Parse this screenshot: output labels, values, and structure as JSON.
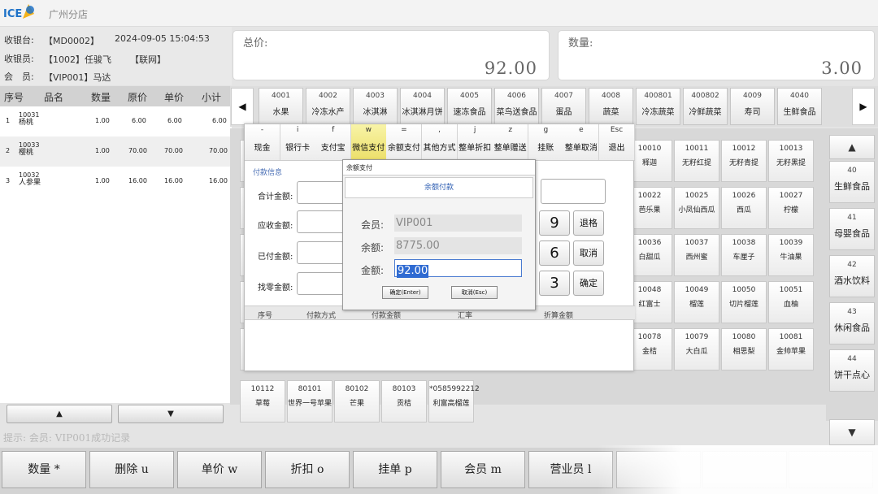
{
  "app": {
    "logo_text": "ICE",
    "store": "广州分店"
  },
  "info": {
    "register_label": "收银台:",
    "register_value": "【MD0002】",
    "datetime": "2024-09-05 15:04:53",
    "cashier_label": "收银员:",
    "cashier_value": "【1002】任骏飞",
    "network": "【联网】",
    "member_label": "会　员:",
    "member_value": "【VIP001】马达"
  },
  "totals": {
    "total_label": "总价:",
    "total_value": "92.00",
    "qty_label": "数量:",
    "qty_value": "3.00"
  },
  "list": {
    "headers": [
      "序号",
      "品名",
      "数量",
      "原价",
      "单价",
      "小计"
    ],
    "rows": [
      {
        "no": "1",
        "code": "10031",
        "name": "杨桃",
        "qty": "1.00",
        "orig": "6.00",
        "price": "6.00",
        "sub": "6.00"
      },
      {
        "no": "2",
        "code": "10033",
        "name": "樱桃",
        "qty": "1.00",
        "orig": "70.00",
        "price": "70.00",
        "sub": "70.00"
      },
      {
        "no": "3",
        "code": "10032",
        "name": "人参果",
        "qty": "1.00",
        "orig": "16.00",
        "price": "16.00",
        "sub": "16.00"
      }
    ],
    "scroll_up": "▲",
    "scroll_down": "▼"
  },
  "hint": "提示: 会员: VIP001成功记录",
  "categories": {
    "prev": "◀",
    "next": "▶",
    "items": [
      {
        "code": "4001",
        "name": "水果"
      },
      {
        "code": "4002",
        "name": "冷冻水产"
      },
      {
        "code": "4003",
        "name": "冰淇淋"
      },
      {
        "code": "4004",
        "name": "冰淇淋月饼"
      },
      {
        "code": "4005",
        "name": "速冻食品"
      },
      {
        "code": "4006",
        "name": "菜鸟送食品"
      },
      {
        "code": "4007",
        "name": "蛋品"
      },
      {
        "code": "4008",
        "name": "蔬菜"
      },
      {
        "code": "400801",
        "name": "冷冻蔬菜"
      },
      {
        "code": "400802",
        "name": "冷鲜蔬菜"
      },
      {
        "code": "4009",
        "name": "寿司"
      },
      {
        "code": "4040",
        "name": "生鲜食品"
      }
    ]
  },
  "products": [
    {
      "code": "10010",
      "name": "释迦"
    },
    {
      "code": "10011",
      "name": "无籽红提"
    },
    {
      "code": "10012",
      "name": "无籽青提"
    },
    {
      "code": "10013",
      "name": "无籽黑提"
    },
    {
      "code": "10022",
      "name": "芭乐果"
    },
    {
      "code": "10025",
      "name": "小凤仙西瓜"
    },
    {
      "code": "10026",
      "name": "西瓜"
    },
    {
      "code": "10027",
      "name": "柠檬"
    },
    {
      "code": "10036",
      "name": "白甜瓜"
    },
    {
      "code": "10037",
      "name": "西州蜜"
    },
    {
      "code": "10038",
      "name": "车厘子"
    },
    {
      "code": "10039",
      "name": "牛油果"
    },
    {
      "code": "10048",
      "name": "红富士"
    },
    {
      "code": "10049",
      "name": "榴莲"
    },
    {
      "code": "10050",
      "name": "切片榴莲"
    },
    {
      "code": "10051",
      "name": "血柚"
    },
    {
      "code": "10078",
      "name": "金桔"
    },
    {
      "code": "10079",
      "name": "大白瓜"
    },
    {
      "code": "10080",
      "name": "相思梨"
    },
    {
      "code": "10081",
      "name": "金帅苹果"
    }
  ],
  "products_bottom": [
    {
      "code": "10112",
      "name": "草莓"
    },
    {
      "code": "80101",
      "name": "世界一号苹果"
    },
    {
      "code": "80102",
      "name": "芒果"
    },
    {
      "code": "80103",
      "name": "贡桔"
    },
    {
      "code": "*0585992212",
      "name": "利富高榴莲"
    }
  ],
  "right_categories": {
    "up": "▲",
    "down": "▼",
    "items": [
      {
        "code": "40",
        "name": "生鲜食品"
      },
      {
        "code": "41",
        "name": "母婴食品"
      },
      {
        "code": "42",
        "name": "酒水饮料"
      },
      {
        "code": "43",
        "name": "休闲食品"
      },
      {
        "code": "44",
        "name": "饼干点心"
      }
    ]
  },
  "bottom_buttons": [
    "数量 *",
    "删除 u",
    "单价 w",
    "折扣 o",
    "挂单 p",
    "会员 m",
    "营业员 l"
  ],
  "payment": {
    "methods": [
      {
        "key": "-",
        "name": "现金"
      },
      {
        "key": "i",
        "name": "银行卡"
      },
      {
        "key": "f",
        "name": "支付宝"
      },
      {
        "key": "w",
        "name": "微信支付"
      },
      {
        "key": "=",
        "name": "余额支付"
      },
      {
        "key": ",",
        "name": "其他方式"
      },
      {
        "key": "j",
        "name": "整单折扣"
      },
      {
        "key": "z",
        "name": "整单赠送"
      },
      {
        "key": "g",
        "name": "挂账"
      },
      {
        "key": "e",
        "name": "整单取消"
      },
      {
        "key": "Esc",
        "name": "退出"
      }
    ],
    "info_title": "付款信息",
    "fields": [
      "合计金额:",
      "应收金额:",
      "已付金额:",
      "找零金额:"
    ],
    "table_headers": [
      "序号",
      "付款方式",
      "付款金额",
      "汇率",
      "折算金额"
    ],
    "keypad": [
      "9",
      "退格",
      "6",
      "取消",
      "3",
      "确定"
    ]
  },
  "balance_dialog": {
    "window_title": "余额支付",
    "header": "余额付款",
    "member_label": "会员:",
    "member_value": "VIP001",
    "balance_label": "余额:",
    "balance_value": "8775.00",
    "amount_label": "金额:",
    "amount_value": "92.00",
    "ok": "确定(Enter)",
    "cancel": "取消(Esc)"
  },
  "colors": {
    "accent": "#2f6bd2",
    "active_method": "#ecdf6a",
    "brand": "#1e72c8"
  }
}
